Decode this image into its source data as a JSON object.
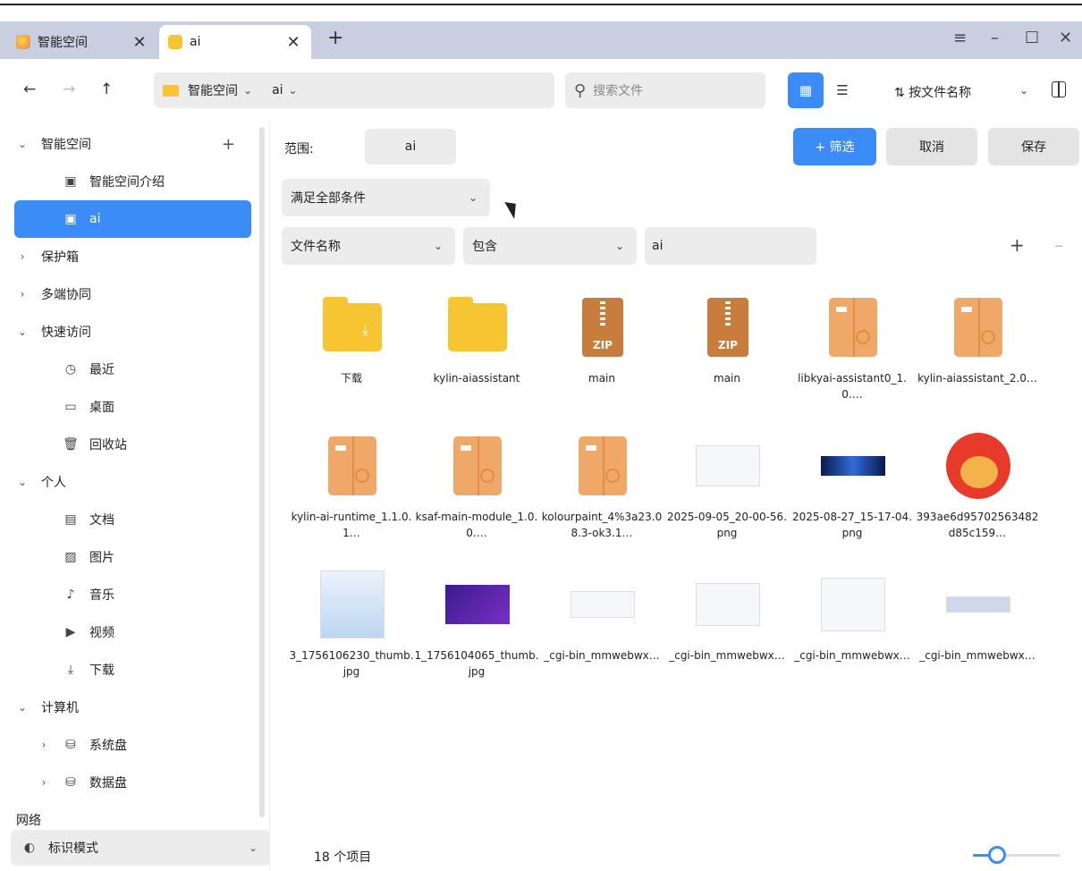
{
  "tabs": [
    {
      "label": "智能空间",
      "close": "✕"
    },
    {
      "label": "ai",
      "close": "✕"
    }
  ],
  "new_tab": "+",
  "window_controls": {
    "menu": "≡",
    "minimize": "–",
    "maximize": "☐",
    "close": "✕"
  },
  "nav": {
    "back": "←",
    "forward": "→",
    "up": "↑"
  },
  "path": {
    "segments": [
      "智能空间",
      "ai"
    ]
  },
  "search": {
    "placeholder": "搜索文件"
  },
  "view": {
    "grid_icon": "▦",
    "list_icon": "☰"
  },
  "sort": {
    "label": "按文件名称",
    "icon": "⇅"
  },
  "sidebar": {
    "items": [
      {
        "label": "智能空间",
        "arrow": "⌄"
      },
      {
        "label": "智能空间介绍",
        "icon": "▣"
      },
      {
        "label": "ai",
        "icon": "▣"
      },
      {
        "label": "保护箱",
        "arrow": "›"
      },
      {
        "label": "多端协同",
        "arrow": "›"
      },
      {
        "label": "快速访问",
        "arrow": "⌄"
      },
      {
        "label": "最近",
        "icon": "◷"
      },
      {
        "label": "桌面",
        "icon": "▭"
      },
      {
        "label": "回收站",
        "icon": "🗑"
      },
      {
        "label": "个人",
        "arrow": "⌄"
      },
      {
        "label": "文档",
        "icon": "▤"
      },
      {
        "label": "图片",
        "icon": "▨"
      },
      {
        "label": "音乐",
        "icon": "♪"
      },
      {
        "label": "视频",
        "icon": "▶"
      },
      {
        "label": "下载",
        "icon": "⤓"
      },
      {
        "label": "计算机",
        "arrow": "⌄"
      },
      {
        "label": "系统盘",
        "arrow": "›",
        "icon": "⛁"
      },
      {
        "label": "数据盘",
        "arrow": "›",
        "icon": "⛁"
      },
      {
        "label": "网络"
      }
    ],
    "plus": "+",
    "mode": {
      "label": "标识模式",
      "icon": "◐",
      "chevron": "⌄"
    }
  },
  "filter": {
    "scope_label": "范围:",
    "scope_value": "ai",
    "filter_button": "+ 筛选",
    "cancel_button": "取消",
    "save_button": "保存",
    "match_mode": "满足全部条件",
    "field": "文件名称",
    "operator": "包含",
    "value": "ai",
    "add": "+",
    "remove": "–"
  },
  "files": [
    {
      "name": "下载",
      "type": "folder-download"
    },
    {
      "name": "kylin-aiassistant",
      "type": "folder"
    },
    {
      "name": "main",
      "type": "zip"
    },
    {
      "name": "main",
      "type": "zip"
    },
    {
      "name": "libkyai-assistant0_1.0.…",
      "type": "deb"
    },
    {
      "name": "kylin-aiassistant_2.0…",
      "type": "deb"
    },
    {
      "name": "kylin-ai-runtime_1.1.0.1…",
      "type": "deb"
    },
    {
      "name": "ksaf-main-module_1.0.0.…",
      "type": "deb"
    },
    {
      "name": "kolourpaint_4%3a23.08.3-ok3.1…",
      "type": "deb"
    },
    {
      "name": "2025-09-05_20-00-56.png",
      "type": "png-light"
    },
    {
      "name": "2025-08-27_15-17-04.png",
      "type": "png-dark"
    },
    {
      "name": "393ae6d95702563482d85c159…",
      "type": "avatar"
    },
    {
      "name": "3_1756106230_thumb.jpg",
      "type": "jpg-blue"
    },
    {
      "name": "1_1756104065_thumb.jpg",
      "type": "jpg-purple"
    },
    {
      "name": "_cgi-bin_mmwebwx…",
      "type": "png-light"
    },
    {
      "name": "_cgi-bin_mmwebwx…",
      "type": "png-light"
    },
    {
      "name": "_cgi-bin_mmwebwx…",
      "type": "png-light"
    },
    {
      "name": "_cgi-bin_mmwebwx…",
      "type": "png-light"
    }
  ],
  "status": {
    "count": "18 个项目"
  },
  "zoom": {
    "level": 0.28
  },
  "colors": {
    "accent": "#3b8cf7",
    "folder": "#f7c531",
    "zip": "#c97d3c",
    "deb": "#f0a868"
  }
}
